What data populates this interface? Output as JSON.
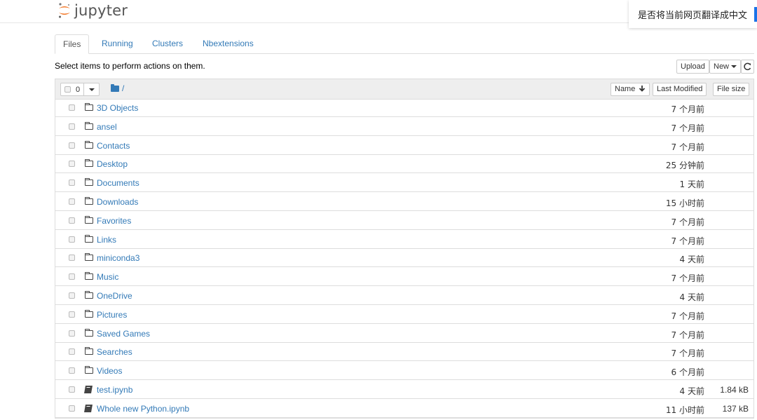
{
  "app": {
    "logo_text": "jupyter"
  },
  "translate": {
    "prompt": "是否将当前网页翻译成中文"
  },
  "tabs": [
    {
      "label": "Files",
      "active": true
    },
    {
      "label": "Running",
      "active": false
    },
    {
      "label": "Clusters",
      "active": false
    },
    {
      "label": "Nbextensions",
      "active": false
    }
  ],
  "toolbar": {
    "instructions": "Select items to perform actions on them.",
    "upload_label": "Upload",
    "new_label": "New",
    "refresh_icon": "refresh-icon"
  },
  "list_header": {
    "selected_count": "0",
    "breadcrumb_path": "/",
    "sort_name_label": "Name",
    "sort_modified_label": "Last Modified",
    "sort_size_label": "File size"
  },
  "files": [
    {
      "name": "3D Objects",
      "type": "folder",
      "modified": "7 个月前",
      "size": ""
    },
    {
      "name": "ansel",
      "type": "folder",
      "modified": "7 个月前",
      "size": ""
    },
    {
      "name": "Contacts",
      "type": "folder",
      "modified": "7 个月前",
      "size": ""
    },
    {
      "name": "Desktop",
      "type": "folder",
      "modified": "25 分钟前",
      "size": ""
    },
    {
      "name": "Documents",
      "type": "folder",
      "modified": "1 天前",
      "size": ""
    },
    {
      "name": "Downloads",
      "type": "folder",
      "modified": "15 小时前",
      "size": ""
    },
    {
      "name": "Favorites",
      "type": "folder",
      "modified": "7 个月前",
      "size": ""
    },
    {
      "name": "Links",
      "type": "folder",
      "modified": "7 个月前",
      "size": ""
    },
    {
      "name": "miniconda3",
      "type": "folder",
      "modified": "4 天前",
      "size": ""
    },
    {
      "name": "Music",
      "type": "folder",
      "modified": "7 个月前",
      "size": ""
    },
    {
      "name": "OneDrive",
      "type": "folder",
      "modified": "4 天前",
      "size": ""
    },
    {
      "name": "Pictures",
      "type": "folder",
      "modified": "7 个月前",
      "size": ""
    },
    {
      "name": "Saved Games",
      "type": "folder",
      "modified": "7 个月前",
      "size": ""
    },
    {
      "name": "Searches",
      "type": "folder",
      "modified": "7 个月前",
      "size": ""
    },
    {
      "name": "Videos",
      "type": "folder",
      "modified": "6 个月前",
      "size": ""
    },
    {
      "name": "test.ipynb",
      "type": "notebook",
      "modified": "4 天前",
      "size": "1.84 kB"
    },
    {
      "name": "Whole new Python.ipynb",
      "type": "notebook",
      "modified": "11 小时前",
      "size": "137 kB"
    }
  ],
  "colors": {
    "link": "#337ab7",
    "jupyter_orange": "#f37726",
    "translate_accent": "#1a73e8"
  }
}
